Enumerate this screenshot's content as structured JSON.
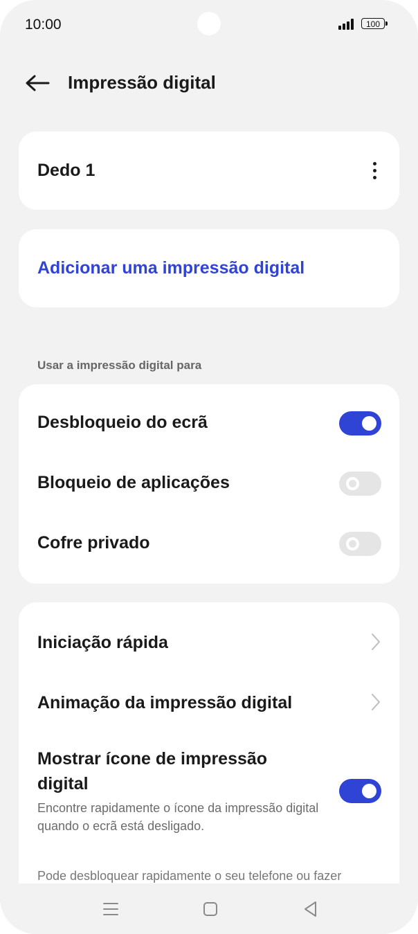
{
  "status_bar": {
    "time": "10:00",
    "battery": "100",
    "icons": [
      "signal-icon",
      "battery-icon"
    ]
  },
  "header": {
    "title": "Impressão digital",
    "back_icon": "arrow-left-icon"
  },
  "fingerprints": [
    {
      "label": "Dedo 1",
      "menu_icon": "more-vertical-icon"
    }
  ],
  "add_fingerprint_label": "Adicionar uma impressão digital",
  "usage_section": {
    "label": "Usar a impressão digital para",
    "items": [
      {
        "label": "Desbloqueio do ecrã",
        "enabled": true
      },
      {
        "label": "Bloqueio de aplicações",
        "enabled": false
      },
      {
        "label": "Cofre privado",
        "enabled": false
      }
    ]
  },
  "settings": {
    "quick_launch": "Iniciação rápida",
    "animation": "Animação da impressão digital",
    "show_icon": {
      "title": "Mostrar ícone de impressão digital",
      "description": "Encontre rapidamente o ícone da impressão digital quando o ecrã está desligado.",
      "enabled": true
    }
  },
  "footer_text": "Pode desbloquear rapidamente o seu telefone ou fazer",
  "nav_bar": {
    "icons": [
      "menu-icon",
      "home-icon",
      "back-icon"
    ]
  },
  "colors": {
    "accent": "#2f43d4",
    "background": "#f2f2f2",
    "card": "#ffffff",
    "toggle_off": "#e5e5e5"
  }
}
